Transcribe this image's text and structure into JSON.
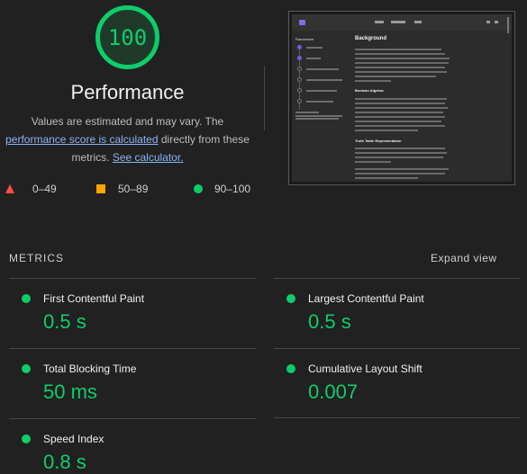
{
  "score": {
    "value": "100",
    "color": "#0cce6b"
  },
  "category": {
    "title": "Performance",
    "description_prefix": "Values are estimated and may vary. The",
    "score_link": "performance score is calculated",
    "description_middle": "directly from these metrics.",
    "calculator_link": "See calculator."
  },
  "legend": [
    {
      "range": "0–49",
      "icon": "fail-triangle-icon",
      "color": "#ff4e42"
    },
    {
      "range": "50–89",
      "icon": "average-square-icon",
      "color": "#ffa400"
    },
    {
      "range": "90–100",
      "icon": "pass-circle-icon",
      "color": "#0cce6b"
    }
  ],
  "screenshot": {
    "sidebar_title": "Randomize",
    "heading1": "Background",
    "heading2": "Boolean Algebra",
    "heading3": "Truth Table Representation"
  },
  "metrics_section": {
    "label": "METRICS",
    "expand_label": "Expand view"
  },
  "metrics": [
    {
      "name": "First Contentful Paint",
      "value": "0.5 s"
    },
    {
      "name": "Largest Contentful Paint",
      "value": "0.5 s"
    },
    {
      "name": "Total Blocking Time",
      "value": "50 ms"
    },
    {
      "name": "Cumulative Layout Shift",
      "value": "0.007"
    },
    {
      "name": "Speed Index",
      "value": "0.8 s"
    }
  ]
}
